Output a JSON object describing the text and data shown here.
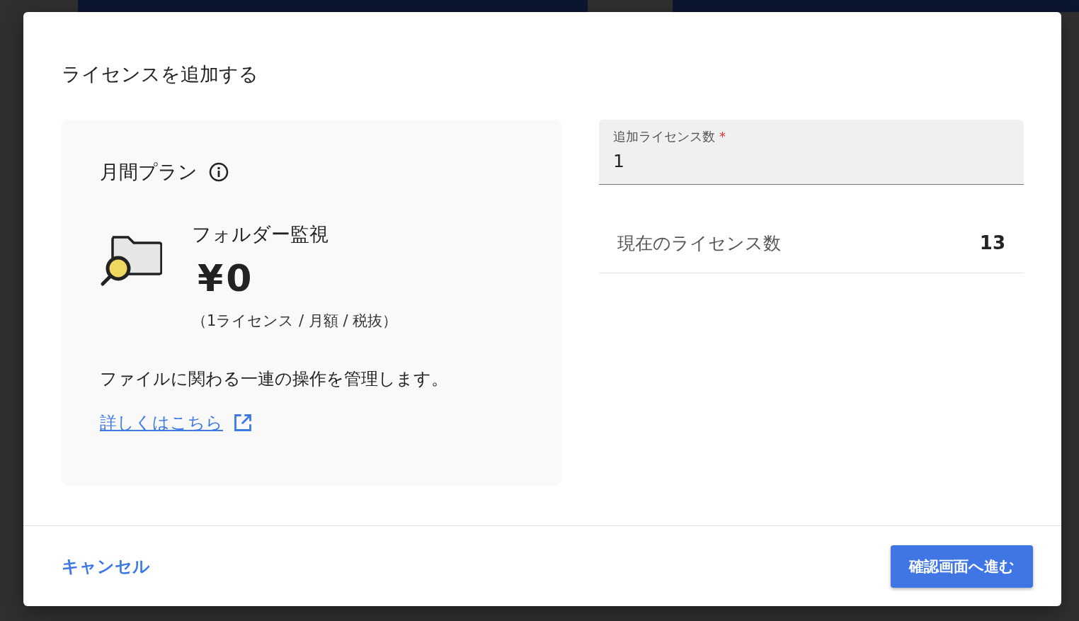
{
  "dialog": {
    "title": "ライセンスを追加する"
  },
  "plan": {
    "name": "月間プラン",
    "product": "フォルダー監視",
    "price": "¥0",
    "price_note": "（1ライセンス / 月額 / 税抜）",
    "description": "ファイルに関わる一連の操作を管理します。",
    "link": "詳しくはこちら"
  },
  "license_field": {
    "label": "追加ライセンス数",
    "required_mark": "*",
    "value": "1"
  },
  "current": {
    "label": "現在のライセンス数",
    "value": "13"
  },
  "footer": {
    "cancel": "キャンセル",
    "confirm": "確認画面へ進む"
  }
}
